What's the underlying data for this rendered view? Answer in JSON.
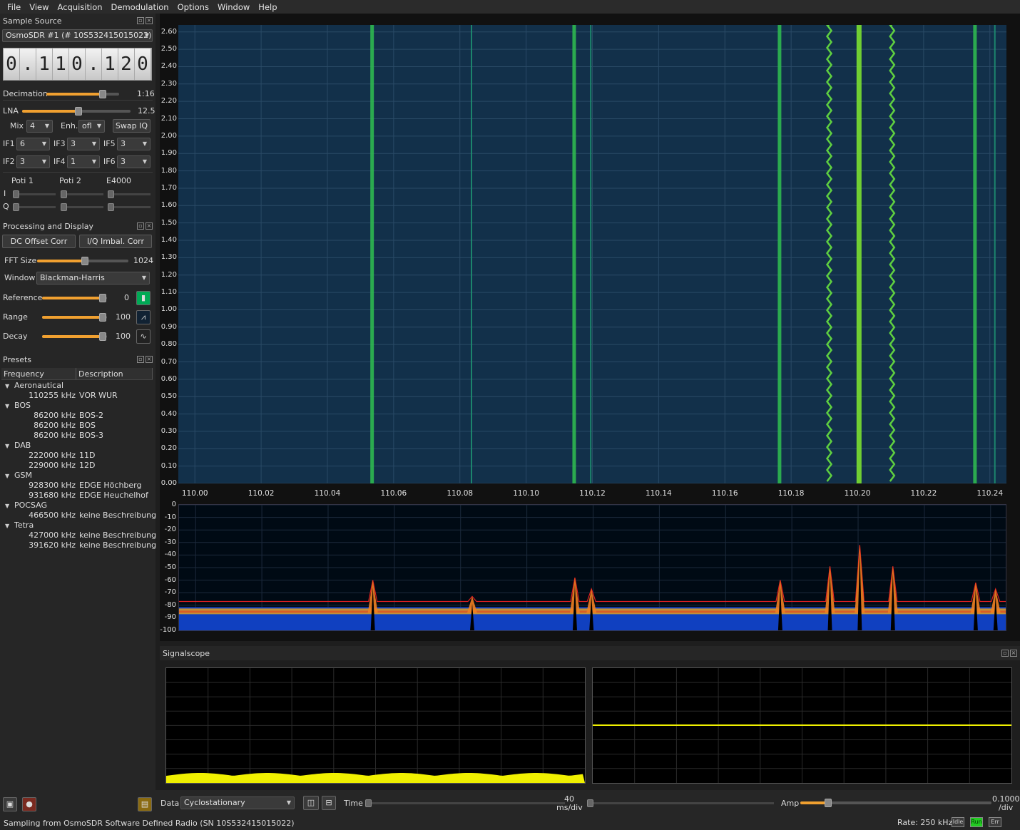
{
  "menu": [
    "File",
    "View",
    "Acquisition",
    "Demodulation",
    "Options",
    "Window",
    "Help"
  ],
  "sample_source": {
    "title": "Sample Source",
    "device": "OsmoSDR #1 (# 10S532415015022)",
    "frequency_digits": [
      "0",
      ".",
      "1",
      "1",
      "0",
      ".",
      "1",
      "2",
      "0"
    ],
    "decimation_label": "Decimation",
    "decimation_value": "1:16",
    "decimation_level": 0.9,
    "lna_label": "LNA",
    "lna_value": "12.5",
    "lna_level": 0.58,
    "mix_label": "Mix",
    "mix_value": "4",
    "enh_label": "Enh.",
    "enh_value": "ofl",
    "swap_iq": "Swap IQ",
    "if1_label": "IF1",
    "if1": "6",
    "if3_label": "IF3",
    "if3": "3",
    "if5_label": "IF5",
    "if5": "3",
    "if2_label": "IF2",
    "if2": "3",
    "if4_label": "IF4",
    "if4": "1",
    "if6_label": "IF6",
    "if6": "3",
    "poti1": "Poti 1",
    "poti2": "Poti 2",
    "e4000": "E4000",
    "i_label": "I",
    "q_label": "Q"
  },
  "processing": {
    "title": "Processing and Display",
    "dc_offset": "DC Offset Corr",
    "iq_imbal": "I/Q Imbal. Corr",
    "fft_label": "FFT Size",
    "fft_value": "1024",
    "fft_level": 0.55,
    "window_label": "Window",
    "window_value": "Blackman-Harris",
    "reference_label": "Reference",
    "reference_value": "0",
    "reference_level": 1.0,
    "range_label": "Range",
    "range_value": "100",
    "range_level": 1.0,
    "decay_label": "Decay",
    "decay_value": "100",
    "decay_level": 1.0
  },
  "presets": {
    "title": "Presets",
    "col_frequency": "Frequency",
    "col_description": "Description",
    "groups": [
      {
        "name": "Aeronautical",
        "items": [
          {
            "f": "110255 kHz",
            "d": "VOR WUR"
          }
        ]
      },
      {
        "name": "BOS",
        "items": [
          {
            "f": "86200 kHz",
            "d": "BOS-2"
          },
          {
            "f": "86200 kHz",
            "d": "BOS"
          },
          {
            "f": "86200 kHz",
            "d": "BOS-3"
          }
        ]
      },
      {
        "name": "DAB",
        "items": [
          {
            "f": "222000 kHz",
            "d": "11D"
          },
          {
            "f": "229000 kHz",
            "d": "12D"
          }
        ]
      },
      {
        "name": "GSM",
        "items": [
          {
            "f": "928300 kHz",
            "d": "EDGE Höchberg"
          },
          {
            "f": "931680 kHz",
            "d": "EDGE Heuchelhof"
          }
        ]
      },
      {
        "name": "POCSAG",
        "items": [
          {
            "f": "466500 kHz",
            "d": "keine Beschreibung"
          }
        ]
      },
      {
        "name": "Tetra",
        "items": [
          {
            "f": "427000 kHz",
            "d": "keine Beschreibung"
          },
          {
            "f": "391620 kHz",
            "d": "keine Beschreibung"
          }
        ]
      }
    ]
  },
  "chart_data": [
    {
      "type": "heatmap",
      "name": "waterfall",
      "x_ticks": [
        "110.00",
        "110.02",
        "110.04",
        "110.06",
        "110.08",
        "110.10",
        "110.12",
        "110.14",
        "110.16",
        "110.18",
        "110.20",
        "110.22",
        "110.24"
      ],
      "y_ticks": [
        "2.60",
        "2.50",
        "2.40",
        "2.30",
        "2.20",
        "2.10",
        "2.00",
        "1.90",
        "1.80",
        "1.70",
        "1.60",
        "1.50",
        "1.40",
        "1.30",
        "1.20",
        "1.10",
        "1.00",
        "0.90",
        "0.80",
        "0.70",
        "0.60",
        "0.50",
        "0.40",
        "0.30",
        "0.20",
        "0.10",
        "0.00"
      ],
      "xlim": [
        109.995,
        110.245
      ],
      "ylim": [
        0,
        2.64
      ],
      "signals_mhz": [
        {
          "f": 110.0535,
          "strength": "strong"
        },
        {
          "f": 110.0835,
          "strength": "weak"
        },
        {
          "f": 110.1145,
          "strength": "strong"
        },
        {
          "f": 110.1195,
          "strength": "weak"
        },
        {
          "f": 110.1765,
          "strength": "strong"
        },
        {
          "f": 110.1915,
          "strength": "fm"
        },
        {
          "f": 110.2005,
          "strength": "strongest"
        },
        {
          "f": 110.2105,
          "strength": "fm"
        },
        {
          "f": 110.2355,
          "strength": "strong"
        },
        {
          "f": 110.2415,
          "strength": "weak"
        }
      ]
    },
    {
      "type": "line",
      "name": "spectrum",
      "y_ticks": [
        "0",
        "-10",
        "-20",
        "-30",
        "-40",
        "-50",
        "-60",
        "-70",
        "-80",
        "-90",
        "-100"
      ],
      "ylim": [
        -100,
        0
      ],
      "noise_floor_db": -86,
      "peak_hold_db": -77,
      "peaks": [
        {
          "f": 110.0535,
          "db": -60
        },
        {
          "f": 110.0835,
          "db": -73
        },
        {
          "f": 110.1145,
          "db": -58
        },
        {
          "f": 110.1195,
          "db": -67
        },
        {
          "f": 110.1765,
          "db": -60
        },
        {
          "f": 110.1915,
          "db": -49
        },
        {
          "f": 110.2005,
          "db": -32
        },
        {
          "f": 110.2105,
          "db": -49
        },
        {
          "f": 110.2355,
          "db": -62
        },
        {
          "f": 110.2415,
          "db": -67
        }
      ]
    }
  ],
  "signalscope": {
    "title": "Signalscope",
    "data_label": "Data",
    "data_value": "Cyclostationary",
    "time_label": "Time",
    "time_value": "40",
    "time_unit": "ms/div",
    "amp_label": "Amp",
    "amp_value": "0.1000",
    "amp_unit": "/div",
    "trace_color": "#f0f000"
  },
  "status": {
    "text": "Sampling from OsmoSDR Software Defined Radio (SN  10S532415015022)",
    "rate": "Rate: 250 kHz",
    "idle": "Idle",
    "run": "Run",
    "err": "Err"
  }
}
